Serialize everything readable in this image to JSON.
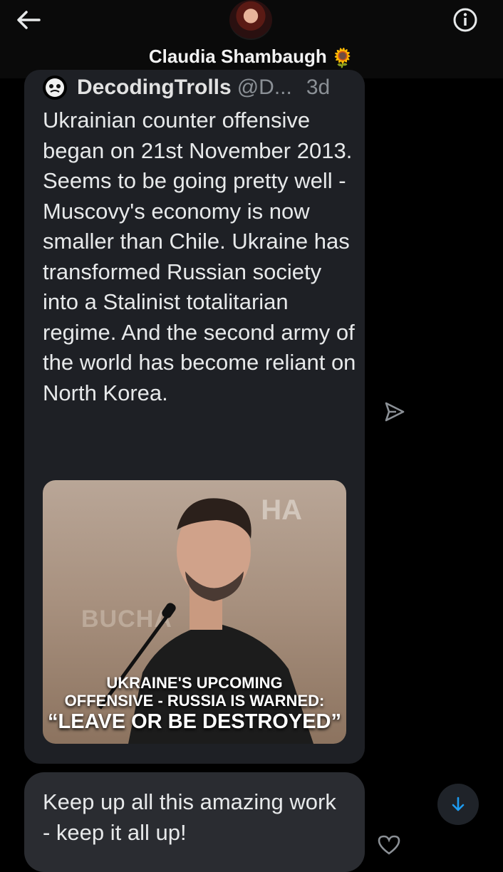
{
  "header": {
    "contact_name": "Claudia Shambaugh",
    "contact_emoji": "🌻",
    "back_icon": "arrow-left-icon",
    "info_icon": "info-icon"
  },
  "tweet": {
    "author_name": "DecodingTrolls",
    "author_handle": "@D...",
    "time": "3d",
    "text": "Ukrainian counter offensive began on 21st November 2013. Seems to be going pretty well - Muscovy's economy is now smaller than Chile. Ukraine has transformed Russian society into a Stalinist totalitarian regime. And the second army of the world has become reliant on North Korea.",
    "image": {
      "caption_line1": "UKRAINE'S UPCOMING",
      "caption_line2": "OFFENSIVE - RUSSIA IS WARNED:",
      "caption_line3": "“LEAVE OR BE DESTROYED”",
      "background_text": "BUCHA",
      "background_text2": "HA"
    }
  },
  "message": {
    "text": "Keep up all this amazing work - keep it all up!"
  },
  "colors": {
    "background": "#000000",
    "card": "#1e2025",
    "bubble": "#2a2c31",
    "accent": "#1d9bf0",
    "muted": "#8b9096"
  }
}
